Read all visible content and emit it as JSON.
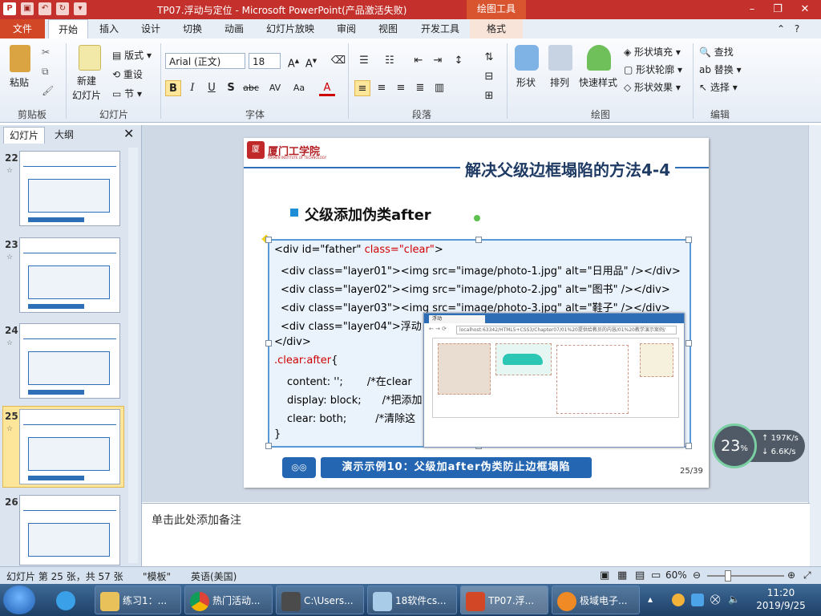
{
  "window": {
    "title": "TP07.浮动与定位 - Microsoft PowerPoint(产品激活失败)",
    "context_tab_group": "绘图工具"
  },
  "ribbon_tabs": [
    "文件",
    "开始",
    "插入",
    "设计",
    "切换",
    "动画",
    "幻灯片放映",
    "审阅",
    "视图",
    "开发工具",
    "格式"
  ],
  "ribbon": {
    "clipboard": {
      "paste": "粘贴",
      "label": "剪贴板"
    },
    "slides": {
      "new_slide": "新建",
      "new_slide2": "幻灯片",
      "layout": "版式",
      "reset": "重设",
      "section": "节",
      "label": "幻灯片"
    },
    "font": {
      "font_name": "Arial (正文)",
      "font_size": "18",
      "bold": "B",
      "italic": "I",
      "underline": "U",
      "shadow": "S",
      "strike": "abc",
      "spacing": "AV",
      "case": "Aa",
      "color": "A",
      "label": "字体"
    },
    "paragraph": {
      "label": "段落"
    },
    "drawing": {
      "shapes": "形状",
      "arrange": "排列",
      "quick_styles": "快速样式",
      "fill": "形状填充",
      "outline": "形状轮廓",
      "effects": "形状效果",
      "label": "绘图"
    },
    "editing": {
      "find": "查找",
      "replace": "替换",
      "select": "选择",
      "label": "编辑"
    }
  },
  "left_panel": {
    "tab_slides": "幻灯片",
    "tab_outline": "大纲",
    "thumbnails": [
      "22",
      "23",
      "24",
      "25",
      "26"
    ],
    "selected": "25"
  },
  "slide": {
    "school_cn": "厦门工学院",
    "school_en": "XIAMEN INSTITUTE OF TECHNOLOGY",
    "title": "解决父级边框塌陷的方法4-4",
    "bullet": "父级添加伪类after",
    "code": {
      "l1a": "<div id=\"father\" ",
      "l1b": "class=\"clear\"",
      "l1c": ">",
      "l2": "<div class=\"layer01\"><img src=\"image/photo-1.jpg\" alt=\"日用品\" /></div>",
      "l3": "<div class=\"layer02\"><img src=\"image/photo-2.jpg\" alt=\"图书\" /></div>",
      "l4": "<div class=\"layer03\"><img src=\"image/photo-3.jpg\" alt=\"鞋子\" /></div>",
      "l5": "<div class=\"layer04\">浮动",
      "l6": "</div>",
      "l7a": ".clear:after",
      "l7b": "{",
      "l8a": "content: '';",
      "l8b": "/*在clear",
      "l9a": "display:  block;",
      "l9b": "/*把添加",
      "l10a": "clear: both;",
      "l10b": "/*清除这",
      "l11": "}"
    },
    "browser": {
      "tab": "浮动",
      "address": "localhost:63342/HTML5+CSS3/Chapter07/01%20提供给教员的内容/01%20教学演示案例/"
    },
    "demo_label": "演示示例10：父级加after伪类防止边框塌陷",
    "page_number": "25/39"
  },
  "net_widget": {
    "cpu": "23",
    "unit": "%",
    "up": "197K/s",
    "down": "6.6K/s"
  },
  "notes_placeholder": "单击此处添加备注",
  "status": {
    "slide_info": "幻灯片 第 25 张，共 57 张",
    "theme": "\"模板\"",
    "language": "英语(美国)",
    "zoom": "60%"
  },
  "taskbar": {
    "items": [
      "练习1：...",
      "热门活动...",
      "C:\\Users...",
      "18软件cs...",
      "TP07.浮...",
      "极域电子..."
    ],
    "time": "11:20",
    "date": "2019/9/25"
  }
}
